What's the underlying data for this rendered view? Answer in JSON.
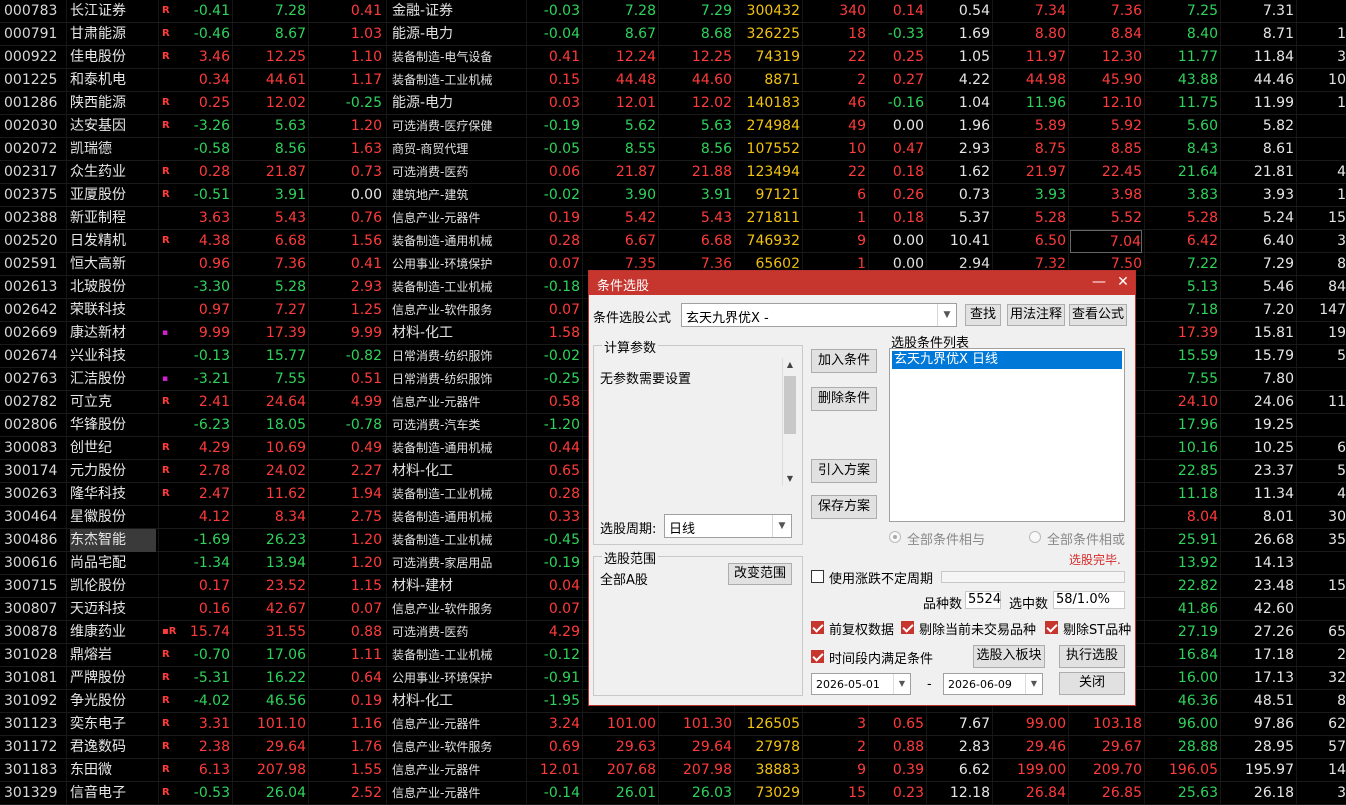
{
  "rows": [
    {
      "code": "000783",
      "name": "长江证券",
      "flag": "R",
      "c1": "-0.41",
      "c2": "7.28",
      "c3": "0.41",
      "ind": "金融-证券",
      "c5": "-0.03",
      "c6": "7.28",
      "c7": "7.29",
      "vol": "300432",
      "c9": "340",
      "c10": "0.14",
      "c11": "0.54",
      "c12": "7.34",
      "c13": "7.36",
      "c14": "7.25",
      "c15": "7.31",
      "c16": ""
    },
    {
      "code": "000791",
      "name": "甘肃能源",
      "flag": "R",
      "c1": "-0.46",
      "c2": "8.67",
      "c3": "1.03",
      "ind": "能源-电力",
      "c5": "-0.04",
      "c6": "8.67",
      "c7": "8.68",
      "vol": "326225",
      "c9": "18",
      "c10": "-0.33",
      "c11": "1.69",
      "c12": "8.80",
      "c13": "8.84",
      "c14": "8.40",
      "c15": "8.71",
      "c16": "1"
    },
    {
      "code": "000922",
      "name": "佳电股份",
      "flag": "R",
      "c1": "3.46",
      "c2": "12.25",
      "c3": "1.10",
      "ind": "装备制造-电气设备",
      "c5": "0.41",
      "c6": "12.24",
      "c7": "12.25",
      "vol": "74319",
      "c9": "22",
      "c10": "0.25",
      "c11": "1.05",
      "c12": "11.97",
      "c13": "12.30",
      "c14": "11.77",
      "c15": "11.84",
      "c16": "3"
    },
    {
      "code": "001225",
      "name": "和泰机电",
      "flag": "",
      "c1": "0.34",
      "c2": "44.61",
      "c3": "1.17",
      "ind": "装备制造-工业机械",
      "c5": "0.15",
      "c6": "44.48",
      "c7": "44.60",
      "vol": "8871",
      "c9": "2",
      "c10": "0.27",
      "c11": "4.22",
      "c12": "44.98",
      "c13": "45.90",
      "c14": "43.88",
      "c15": "44.46",
      "c16": "10"
    },
    {
      "code": "001286",
      "name": "陕西能源",
      "flag": "R",
      "c1": "0.25",
      "c2": "12.02",
      "c3": "-0.25",
      "ind": "能源-电力",
      "c5": "0.03",
      "c6": "12.01",
      "c7": "12.02",
      "vol": "140183",
      "c9": "46",
      "c10": "-0.16",
      "c11": "1.04",
      "c12": "11.96",
      "c13": "12.10",
      "c14": "11.75",
      "c15": "11.99",
      "c16": "1"
    },
    {
      "code": "002030",
      "name": "达安基因",
      "flag": "R",
      "c1": "-3.26",
      "c2": "5.63",
      "c3": "1.20",
      "ind": "可选消费-医疗保健",
      "c5": "-0.19",
      "c6": "5.62",
      "c7": "5.63",
      "vol": "274984",
      "c9": "49",
      "c10": "0.00",
      "c11": "1.96",
      "c12": "5.89",
      "c13": "5.92",
      "c14": "5.60",
      "c15": "5.82",
      "c16": ""
    },
    {
      "code": "002072",
      "name": "凯瑞德",
      "flag": "",
      "c1": "-0.58",
      "c2": "8.56",
      "c3": "1.63",
      "ind": "商贸-商贸代理",
      "c5": "-0.05",
      "c6": "8.55",
      "c7": "8.56",
      "vol": "107552",
      "c9": "10",
      "c10": "0.47",
      "c11": "2.93",
      "c12": "8.75",
      "c13": "8.85",
      "c14": "8.43",
      "c15": "8.61",
      "c16": ""
    },
    {
      "code": "002317",
      "name": "众生药业",
      "flag": "R",
      "c1": "0.28",
      "c2": "21.87",
      "c3": "0.73",
      "ind": "可选消费-医药",
      "c5": "0.06",
      "c6": "21.87",
      "c7": "21.88",
      "vol": "123494",
      "c9": "22",
      "c10": "0.18",
      "c11": "1.62",
      "c12": "21.97",
      "c13": "22.45",
      "c14": "21.64",
      "c15": "21.81",
      "c16": "4"
    },
    {
      "code": "002375",
      "name": "亚厦股份",
      "flag": "R",
      "c1": "-0.51",
      "c2": "3.91",
      "c3": "0.00",
      "ind": "建筑地产-建筑",
      "c5": "-0.02",
      "c6": "3.90",
      "c7": "3.91",
      "vol": "97121",
      "c9": "6",
      "c10": "0.26",
      "c11": "0.73",
      "c12": "3.93",
      "c13": "3.98",
      "c14": "3.83",
      "c15": "3.93",
      "c16": "1"
    },
    {
      "code": "002388",
      "name": "新亚制程",
      "flag": "",
      "c1": "3.63",
      "c2": "5.43",
      "c3": "0.76",
      "ind": "信息产业-元器件",
      "c5": "0.19",
      "c6": "5.42",
      "c7": "5.43",
      "vol": "271811",
      "c9": "1",
      "c10": "0.18",
      "c11": "5.37",
      "c12": "5.28",
      "c13": "5.52",
      "c14": "5.28",
      "c15": "5.24",
      "c16": "15"
    },
    {
      "code": "002520",
      "name": "日发精机",
      "flag": "R",
      "c1": "4.38",
      "c2": "6.68",
      "c3": "1.56",
      "ind": "装备制造-通用机械",
      "c5": "0.28",
      "c6": "6.67",
      "c7": "6.68",
      "vol": "746932",
      "c9": "9",
      "c10": "0.00",
      "c11": "10.41",
      "c12": "6.50",
      "c13": "7.04",
      "c14": "6.42",
      "c15": "6.40",
      "c16": "3"
    },
    {
      "code": "002591",
      "name": "恒大高新",
      "flag": "",
      "c1": "0.96",
      "c2": "7.36",
      "c3": "0.41",
      "ind": "公用事业-环境保护",
      "c5": "0.07",
      "c6": "7.35",
      "c7": "7.36",
      "vol": "65602",
      "c9": "1",
      "c10": "0.00",
      "c11": "2.94",
      "c12": "7.32",
      "c13": "7.50",
      "c14": "7.22",
      "c15": "7.29",
      "c16": "8"
    },
    {
      "code": "002613",
      "name": "北玻股份",
      "flag": "",
      "c1": "-3.30",
      "c2": "5.28",
      "c3": "2.93",
      "ind": "装备制造-工业机械",
      "c5": "-0.18",
      "c6": "",
      "c7": "",
      "vol": "",
      "c9": "",
      "c10": "",
      "c11": "",
      "c12": "",
      "c13": "",
      "c14": "5.13",
      "c15": "5.46",
      "c16": "84"
    },
    {
      "code": "002642",
      "name": "荣联科技",
      "flag": "",
      "c1": "0.97",
      "c2": "7.27",
      "c3": "1.25",
      "ind": "信息产业-软件服务",
      "c5": "0.07",
      "c6": "",
      "c7": "",
      "vol": "",
      "c9": "",
      "c10": "",
      "c11": "",
      "c12": "",
      "c13": "",
      "c14": "7.18",
      "c15": "7.20",
      "c16": "147"
    },
    {
      "code": "002669",
      "name": "康达新材",
      "flag": "▪",
      "c1": "9.99",
      "c2": "17.39",
      "c3": "9.99",
      "ind": "材料-化工",
      "c5": "1.58",
      "c6": "",
      "c7": "",
      "vol": "",
      "c9": "",
      "c10": "",
      "c11": "",
      "c12": "",
      "c13": "",
      "c14": "17.39",
      "c15": "15.81",
      "c16": "19"
    },
    {
      "code": "002674",
      "name": "兴业科技",
      "flag": "",
      "c1": "-0.13",
      "c2": "15.77",
      "c3": "-0.82",
      "ind": "日常消费-纺织服饰",
      "c5": "-0.02",
      "c6": "",
      "c7": "",
      "vol": "",
      "c9": "",
      "c10": "",
      "c11": "",
      "c12": "",
      "c13": "",
      "c14": "15.59",
      "c15": "15.79",
      "c16": "5"
    },
    {
      "code": "002763",
      "name": "汇洁股份",
      "flag": "▪",
      "c1": "-3.21",
      "c2": "7.55",
      "c3": "0.51",
      "ind": "日常消费-纺织服饰",
      "c5": "-0.25",
      "c6": "",
      "c7": "",
      "vol": "",
      "c9": "",
      "c10": "",
      "c11": "",
      "c12": "",
      "c13": "",
      "c14": "7.55",
      "c15": "7.80",
      "c16": ""
    },
    {
      "code": "002782",
      "name": "可立克",
      "flag": "R",
      "c1": "2.41",
      "c2": "24.64",
      "c3": "4.99",
      "ind": "信息产业-元器件",
      "c5": "0.58",
      "c6": "",
      "c7": "",
      "vol": "",
      "c9": "",
      "c10": "",
      "c11": "",
      "c12": "",
      "c13": "",
      "c14": "24.10",
      "c15": "24.06",
      "c16": "11"
    },
    {
      "code": "002806",
      "name": "华锋股份",
      "flag": "",
      "c1": "-6.23",
      "c2": "18.05",
      "c3": "-0.78",
      "ind": "可选消费-汽车类",
      "c5": "-1.20",
      "c6": "",
      "c7": "",
      "vol": "",
      "c9": "",
      "c10": "",
      "c11": "",
      "c12": "",
      "c13": "",
      "c14": "17.96",
      "c15": "19.25",
      "c16": ""
    },
    {
      "code": "300083",
      "name": "创世纪",
      "flag": "R",
      "c1": "4.29",
      "c2": "10.69",
      "c3": "0.49",
      "ind": "装备制造-通用机械",
      "c5": "0.44",
      "c6": "",
      "c7": "",
      "vol": "",
      "c9": "",
      "c10": "",
      "c11": "",
      "c12": "",
      "c13": "",
      "c14": "10.16",
      "c15": "10.25",
      "c16": "6"
    },
    {
      "code": "300174",
      "name": "元力股份",
      "flag": "R",
      "c1": "2.78",
      "c2": "24.02",
      "c3": "2.27",
      "ind": "材料-化工",
      "c5": "0.65",
      "c6": "",
      "c7": "",
      "vol": "",
      "c9": "",
      "c10": "",
      "c11": "",
      "c12": "",
      "c13": "",
      "c14": "22.85",
      "c15": "23.37",
      "c16": "5"
    },
    {
      "code": "300263",
      "name": "隆华科技",
      "flag": "R",
      "c1": "2.47",
      "c2": "11.62",
      "c3": "1.94",
      "ind": "装备制造-工业机械",
      "c5": "0.28",
      "c6": "",
      "c7": "",
      "vol": "",
      "c9": "",
      "c10": "",
      "c11": "",
      "c12": "",
      "c13": "",
      "c14": "11.18",
      "c15": "11.34",
      "c16": "4"
    },
    {
      "code": "300464",
      "name": "星徽股份",
      "flag": "",
      "c1": "4.12",
      "c2": "8.34",
      "c3": "2.75",
      "ind": "装备制造-通用机械",
      "c5": "0.33",
      "c6": "",
      "c7": "",
      "vol": "",
      "c9": "",
      "c10": "",
      "c11": "",
      "c12": "",
      "c13": "",
      "c14": "8.04",
      "c15": "8.01",
      "c16": "30"
    },
    {
      "code": "300486",
      "name": "东杰智能",
      "flag": "",
      "c1": "-1.69",
      "c2": "26.23",
      "c3": "1.20",
      "ind": "装备制造-工业机械",
      "c5": "-0.45",
      "c6": "",
      "c7": "",
      "vol": "",
      "c9": "",
      "c10": "",
      "c11": "",
      "c12": "",
      "c13": "",
      "c14": "25.91",
      "c15": "26.68",
      "c16": "35"
    },
    {
      "code": "300616",
      "name": "尚品宅配",
      "flag": "",
      "c1": "-1.34",
      "c2": "13.94",
      "c3": "1.20",
      "ind": "可选消费-家居用品",
      "c5": "-0.19",
      "c6": "",
      "c7": "",
      "vol": "",
      "c9": "",
      "c10": "",
      "c11": "",
      "c12": "",
      "c13": "",
      "c14": "13.92",
      "c15": "14.13",
      "c16": ""
    },
    {
      "code": "300715",
      "name": "凯伦股份",
      "flag": "",
      "c1": "0.17",
      "c2": "23.52",
      "c3": "1.15",
      "ind": "材料-建材",
      "c5": "0.04",
      "c6": "",
      "c7": "",
      "vol": "",
      "c9": "",
      "c10": "",
      "c11": "",
      "c12": "",
      "c13": "",
      "c14": "22.82",
      "c15": "23.48",
      "c16": "15"
    },
    {
      "code": "300807",
      "name": "天迈科技",
      "flag": "",
      "c1": "0.16",
      "c2": "42.67",
      "c3": "0.07",
      "ind": "信息产业-软件服务",
      "c5": "0.07",
      "c6": "",
      "c7": "",
      "vol": "",
      "c9": "",
      "c10": "",
      "c11": "",
      "c12": "",
      "c13": "",
      "c14": "41.86",
      "c15": "42.60",
      "c16": ""
    },
    {
      "code": "300878",
      "name": "维康药业",
      "flag": "▪R",
      "c1": "15.74",
      "c2": "31.55",
      "c3": "0.88",
      "ind": "可选消费-医药",
      "c5": "4.29",
      "c6": "",
      "c7": "",
      "vol": "",
      "c9": "",
      "c10": "",
      "c11": "",
      "c12": "",
      "c13": "",
      "c14": "27.19",
      "c15": "27.26",
      "c16": "65"
    },
    {
      "code": "301028",
      "name": "鼎熔岩",
      "flag": "R",
      "c1": "-0.70",
      "c2": "17.06",
      "c3": "1.11",
      "ind": "装备制造-工业机械",
      "c5": "-0.12",
      "c6": "",
      "c7": "",
      "vol": "",
      "c9": "",
      "c10": "",
      "c11": "",
      "c12": "",
      "c13": "",
      "c14": "16.84",
      "c15": "17.18",
      "c16": "2"
    },
    {
      "code": "301081",
      "name": "严牌股份",
      "flag": "R",
      "c1": "-5.31",
      "c2": "16.22",
      "c3": "0.64",
      "ind": "公用事业-环境保护",
      "c5": "-0.91",
      "c6": "",
      "c7": "",
      "vol": "",
      "c9": "",
      "c10": "",
      "c11": "",
      "c12": "",
      "c13": "",
      "c14": "16.00",
      "c15": "17.13",
      "c16": "32"
    },
    {
      "code": "301092",
      "name": "争光股份",
      "flag": "R",
      "c1": "-4.02",
      "c2": "46.56",
      "c3": "0.19",
      "ind": "材料-化工",
      "c5": "-1.95",
      "c6": "",
      "c7": "",
      "vol": "",
      "c9": "",
      "c10": "",
      "c11": "",
      "c12": "",
      "c13": "",
      "c14": "46.36",
      "c15": "48.51",
      "c16": "8"
    },
    {
      "code": "301123",
      "name": "奕东电子",
      "flag": "R",
      "c1": "3.31",
      "c2": "101.10",
      "c3": "1.16",
      "ind": "信息产业-元器件",
      "c5": "3.24",
      "c6": "101.00",
      "c7": "101.30",
      "vol": "126505",
      "c9": "3",
      "c10": "0.65",
      "c11": "7.67",
      "c12": "99.00",
      "c13": "103.18",
      "c14": "96.00",
      "c15": "97.86",
      "c16": "62"
    },
    {
      "code": "301172",
      "name": "君逸数码",
      "flag": "R",
      "c1": "2.38",
      "c2": "29.64",
      "c3": "1.76",
      "ind": "信息产业-软件服务",
      "c5": "0.69",
      "c6": "29.63",
      "c7": "29.64",
      "vol": "27978",
      "c9": "2",
      "c10": "0.88",
      "c11": "2.83",
      "c12": "29.46",
      "c13": "29.67",
      "c14": "28.88",
      "c15": "28.95",
      "c16": "57"
    },
    {
      "code": "301183",
      "name": "东田微",
      "flag": "R",
      "c1": "6.13",
      "c2": "207.98",
      "c3": "1.55",
      "ind": "信息产业-元器件",
      "c5": "12.01",
      "c6": "207.68",
      "c7": "207.98",
      "vol": "38883",
      "c9": "9",
      "c10": "0.39",
      "c11": "6.62",
      "c12": "199.00",
      "c13": "209.70",
      "c14": "196.05",
      "c15": "195.97",
      "c16": "14"
    },
    {
      "code": "301329",
      "name": "信音电子",
      "flag": "R",
      "c1": "-0.53",
      "c2": "26.04",
      "c3": "2.52",
      "ind": "信息产业-元器件",
      "c5": "-0.14",
      "c6": "26.01",
      "c7": "26.03",
      "vol": "73029",
      "c9": "15",
      "c10": "0.23",
      "c11": "12.18",
      "c12": "26.84",
      "c13": "26.85",
      "c14": "25.63",
      "c15": "26.18",
      "c16": "3"
    }
  ],
  "dialog": {
    "title": "条件选股",
    "minimize": "—",
    "close": "✕",
    "formula_label": "条件选股公式",
    "formula_value": "玄天九界优X  -",
    "find_btn": "查找",
    "usage_btn": "用法注释",
    "view_formula_btn": "查看公式",
    "params_group": "计算参数",
    "params_text": "无参数需要设置",
    "period_label": "选股周期:",
    "period_value": "日线",
    "add_cond": "加入条件",
    "del_cond": "删除条件",
    "import_plan": "引入方案",
    "save_plan": "保存方案",
    "cond_list_label": "选股条件列表",
    "cond_item": "玄天九界优X  日线",
    "radio_and": "全部条件相与",
    "radio_or": "全部条件相或",
    "status": "选股完毕.",
    "range_group": "选股范围",
    "range_value": "全部A股",
    "change_range": "改变范围",
    "use_uncertain": "使用涨跌不定周期",
    "count_label": "品种数",
    "count_value": "5524",
    "selected_label": "选中数",
    "selected_value": "58/1.0%",
    "fq": "前复权数据",
    "exclude_untraded": "剔除当前未交易品种",
    "exclude_st": "剔除ST品种",
    "time_range": "时间段内满足条件",
    "to_block": "选股入板块",
    "execute": "执行选股",
    "date_from": "2026-05-01",
    "date_sep": "-",
    "date_to": "2026-06-09",
    "close_btn": "关闭"
  },
  "colors": {
    "up": "#ff3b3b",
    "down": "#2fd35c",
    "accent": "#c7352f",
    "vol": "#f2c311"
  }
}
